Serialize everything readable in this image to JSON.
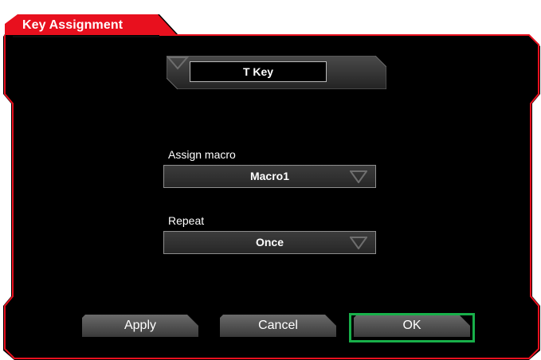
{
  "dialog": {
    "title": "Key Assignment",
    "accent_color": "#e8101e",
    "background_color": "#000000"
  },
  "key_selector": {
    "value": "T Key",
    "arrow_icon": "triangle-down-icon"
  },
  "assign_macro": {
    "label": "Assign macro",
    "value": "Macro1",
    "arrow_icon": "triangle-down-icon"
  },
  "repeat": {
    "label": "Repeat",
    "value": "Once",
    "arrow_icon": "triangle-down-icon"
  },
  "buttons": {
    "apply": "Apply",
    "cancel": "Cancel",
    "ok": "OK",
    "focused": "ok",
    "focus_color": "#18b04a"
  }
}
